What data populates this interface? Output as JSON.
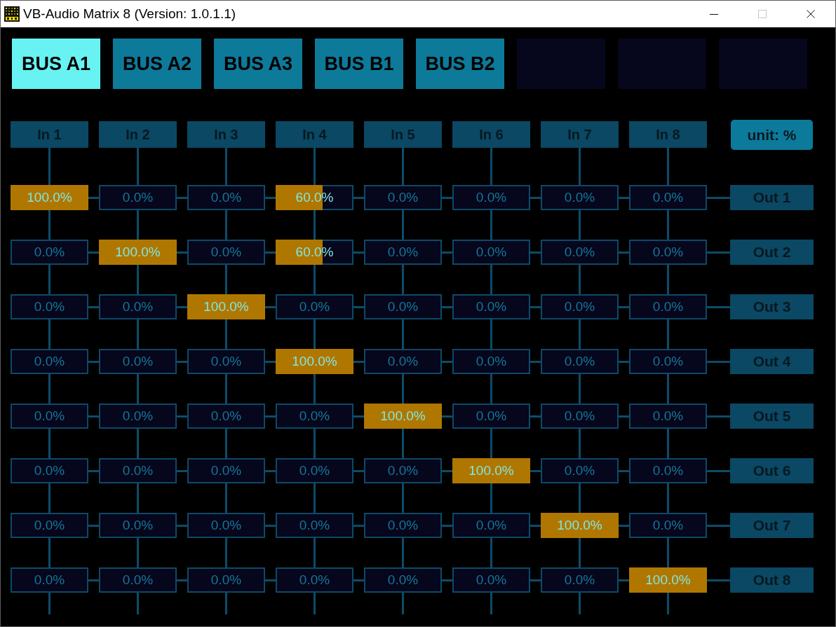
{
  "window": {
    "title": "VB-Audio Matrix 8 (Version: 1.0.1.1)",
    "controls": [
      {
        "kind": "minimize",
        "disabled": false
      },
      {
        "kind": "maximize",
        "disabled": true
      },
      {
        "kind": "close",
        "disabled": false
      }
    ]
  },
  "bus_tabs": [
    {
      "kind": "bus",
      "label": "BUS A1",
      "selected": true
    },
    {
      "kind": "bus",
      "label": "BUS A2",
      "selected": false
    },
    {
      "kind": "bus",
      "label": "BUS A3",
      "selected": false
    },
    {
      "kind": "bus",
      "label": "BUS B1",
      "selected": false
    },
    {
      "kind": "bus",
      "label": "BUS B2",
      "selected": false
    },
    {
      "kind": "empty",
      "selected": false
    },
    {
      "kind": "empty",
      "selected": false
    },
    {
      "kind": "empty",
      "selected": false
    }
  ],
  "matrix": {
    "inputs": [
      "In 1",
      "In 2",
      "In 3",
      "In 4",
      "In 5",
      "In 6",
      "In 7",
      "In 8"
    ],
    "unit_button": "unit: %",
    "outputs": [
      {
        "label": "Out 1",
        "cells": [
          {
            "value": "100.0%",
            "level": 1
          },
          {
            "value": "0.0%",
            "level": 0
          },
          {
            "value": "0.0%",
            "level": 0
          },
          {
            "value": "60.0%",
            "level": 0.6
          },
          {
            "value": "0.0%",
            "level": 0
          },
          {
            "value": "0.0%",
            "level": 0
          },
          {
            "value": "0.0%",
            "level": 0
          },
          {
            "value": "0.0%",
            "level": 0
          }
        ]
      },
      {
        "label": "Out 2",
        "cells": [
          {
            "value": "0.0%",
            "level": 0
          },
          {
            "value": "100.0%",
            "level": 1
          },
          {
            "value": "0.0%",
            "level": 0
          },
          {
            "value": "60.0%",
            "level": 0.6
          },
          {
            "value": "0.0%",
            "level": 0
          },
          {
            "value": "0.0%",
            "level": 0
          },
          {
            "value": "0.0%",
            "level": 0
          },
          {
            "value": "0.0%",
            "level": 0
          }
        ]
      },
      {
        "label": "Out 3",
        "cells": [
          {
            "value": "0.0%",
            "level": 0
          },
          {
            "value": "0.0%",
            "level": 0
          },
          {
            "value": "100.0%",
            "level": 1
          },
          {
            "value": "0.0%",
            "level": 0
          },
          {
            "value": "0.0%",
            "level": 0
          },
          {
            "value": "0.0%",
            "level": 0
          },
          {
            "value": "0.0%",
            "level": 0
          },
          {
            "value": "0.0%",
            "level": 0
          }
        ]
      },
      {
        "label": "Out 4",
        "cells": [
          {
            "value": "0.0%",
            "level": 0
          },
          {
            "value": "0.0%",
            "level": 0
          },
          {
            "value": "0.0%",
            "level": 0
          },
          {
            "value": "100.0%",
            "level": 1
          },
          {
            "value": "0.0%",
            "level": 0
          },
          {
            "value": "0.0%",
            "level": 0
          },
          {
            "value": "0.0%",
            "level": 0
          },
          {
            "value": "0.0%",
            "level": 0
          }
        ]
      },
      {
        "label": "Out 5",
        "cells": [
          {
            "value": "0.0%",
            "level": 0
          },
          {
            "value": "0.0%",
            "level": 0
          },
          {
            "value": "0.0%",
            "level": 0
          },
          {
            "value": "0.0%",
            "level": 0
          },
          {
            "value": "100.0%",
            "level": 1
          },
          {
            "value": "0.0%",
            "level": 0
          },
          {
            "value": "0.0%",
            "level": 0
          },
          {
            "value": "0.0%",
            "level": 0
          }
        ]
      },
      {
        "label": "Out 6",
        "cells": [
          {
            "value": "0.0%",
            "level": 0
          },
          {
            "value": "0.0%",
            "level": 0
          },
          {
            "value": "0.0%",
            "level": 0
          },
          {
            "value": "0.0%",
            "level": 0
          },
          {
            "value": "0.0%",
            "level": 0
          },
          {
            "value": "100.0%",
            "level": 1
          },
          {
            "value": "0.0%",
            "level": 0
          },
          {
            "value": "0.0%",
            "level": 0
          }
        ]
      },
      {
        "label": "Out 7",
        "cells": [
          {
            "value": "0.0%",
            "level": 0
          },
          {
            "value": "0.0%",
            "level": 0
          },
          {
            "value": "0.0%",
            "level": 0
          },
          {
            "value": "0.0%",
            "level": 0
          },
          {
            "value": "0.0%",
            "level": 0
          },
          {
            "value": "0.0%",
            "level": 0
          },
          {
            "value": "100.0%",
            "level": 1
          },
          {
            "value": "0.0%",
            "level": 0
          }
        ]
      },
      {
        "label": "Out 8",
        "cells": [
          {
            "value": "0.0%",
            "level": 0
          },
          {
            "value": "0.0%",
            "level": 0
          },
          {
            "value": "0.0%",
            "level": 0
          },
          {
            "value": "0.0%",
            "level": 0
          },
          {
            "value": "0.0%",
            "level": 0
          },
          {
            "value": "0.0%",
            "level": 0
          },
          {
            "value": "0.0%",
            "level": 0
          },
          {
            "value": "100.0%",
            "level": 1
          }
        ]
      }
    ]
  }
}
